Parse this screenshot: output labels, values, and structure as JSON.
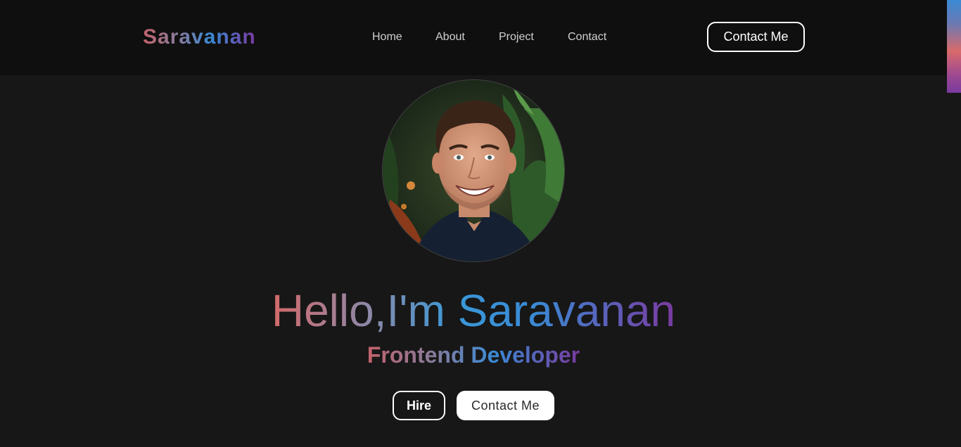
{
  "header": {
    "logo": "Saravanan",
    "nav": [
      "Home",
      "About",
      "Project",
      "Contact"
    ],
    "cta_label": "Contact Me"
  },
  "hero": {
    "title": "Hello,I'm Saravanan",
    "subtitle": "Frontend Developer",
    "hire_label": "Hire",
    "contact_label": "Contact Me"
  },
  "colors": {
    "background": "#171717",
    "header_background": "#0f0f0f",
    "gradient_start": "#c4626b",
    "gradient_mid": "#3a8ad4",
    "gradient_end": "#7a3aa0"
  }
}
